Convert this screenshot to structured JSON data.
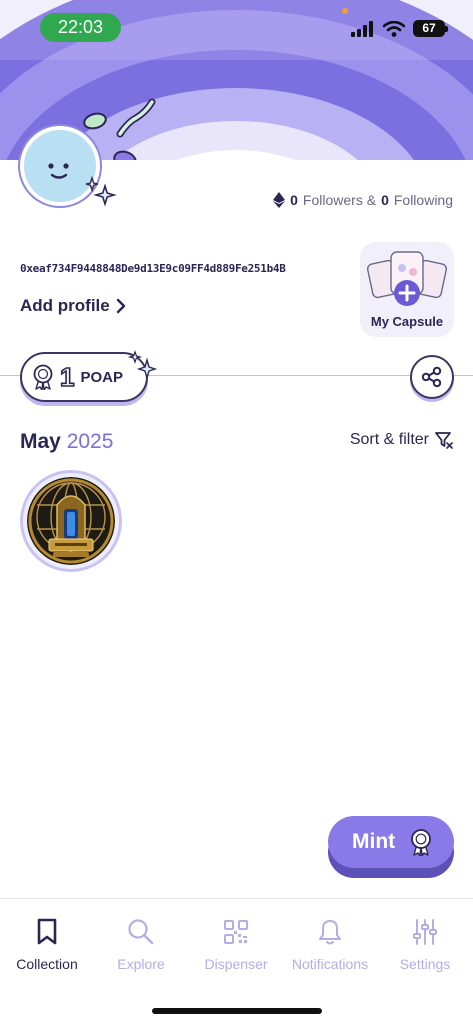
{
  "status_bar": {
    "time": "22:03",
    "battery": "67"
  },
  "profile": {
    "followers_count": "0",
    "followers_label": "Followers &",
    "following_count": "0",
    "following_label": "Following",
    "address": "0xeaf734F9448848De9d13E9c09FF4d889Fe251b4B",
    "add_profile_label": "Add profile",
    "capsule_label": "My Capsule"
  },
  "collection": {
    "poap_count": "1",
    "poap_label": "POAP",
    "month": "May",
    "year": "2025",
    "sort_filter_label": "Sort & filter"
  },
  "mint_label": "Mint",
  "tabs": [
    {
      "label": "Collection",
      "icon": "bookmark-icon",
      "active": true
    },
    {
      "label": "Explore",
      "icon": "search-icon",
      "active": false
    },
    {
      "label": "Dispenser",
      "icon": "qr-code-icon",
      "active": false
    },
    {
      "label": "Notifications",
      "icon": "bell-icon",
      "active": false
    },
    {
      "label": "Settings",
      "icon": "sliders-icon",
      "active": false
    }
  ],
  "colors": {
    "accent": "#8a7ae8",
    "text": "#2b2653",
    "inactive": "#b3aee5"
  }
}
